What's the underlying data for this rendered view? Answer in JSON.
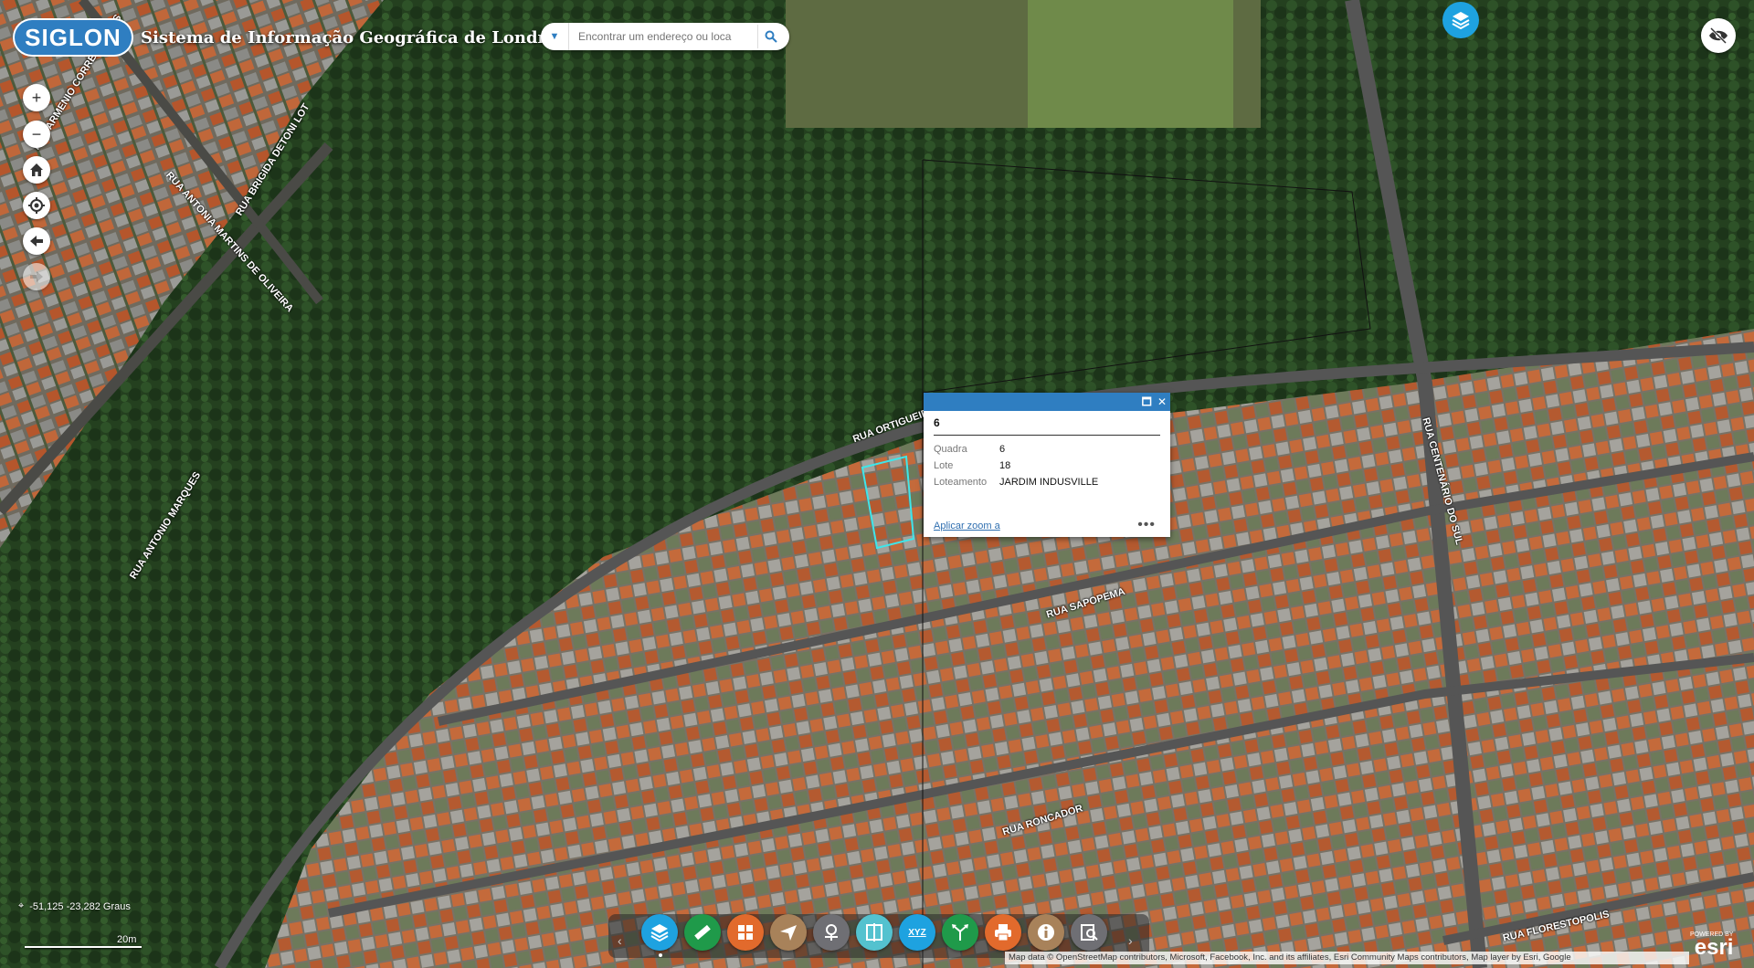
{
  "header": {
    "logo_text": "SIGLON",
    "title": "Sistema de Informação Geográfica de Londrina"
  },
  "search": {
    "placeholder": "Encontrar um endereço ou loca"
  },
  "nav": {
    "zoom_in": "+",
    "zoom_out": "−"
  },
  "streets": [
    {
      "label": "RUA ARMENIO CORREIA LENOS"
    },
    {
      "label": "RUA BRIGIDA DETONI LOT"
    },
    {
      "label": "RUA ANTONIA MARTINS DE OLIVEIRA"
    },
    {
      "label": "RUA ANTONIO MARQUES"
    },
    {
      "label": "RUA ORTIGUEIRA"
    },
    {
      "label": "RUA SAPOPEMA"
    },
    {
      "label": "RUA CENTENÁRIO DO SUL"
    },
    {
      "label": "RUA RONCADOR"
    },
    {
      "label": "RUA FLORESTOPOLIS"
    }
  ],
  "popup": {
    "title": "6",
    "fields": [
      {
        "key": "Quadra",
        "value": "6"
      },
      {
        "key": "Lote",
        "value": "18"
      },
      {
        "key": "Loteamento",
        "value": "JARDIM INDUSVILLE"
      }
    ],
    "zoom_link": "Aplicar zoom a",
    "more": "•••"
  },
  "coords": {
    "text": "-51,125 -23,282 Graus"
  },
  "scale": {
    "label": "20m"
  },
  "toolbar": {
    "tools": [
      {
        "name": "layers-tool",
        "color": "#1ea2e0"
      },
      {
        "name": "measure-tool",
        "color": "#1f9a4a"
      },
      {
        "name": "basemap-gallery-tool",
        "color": "#e26a2c"
      },
      {
        "name": "filter-tool",
        "color": "#a8825a"
      },
      {
        "name": "locate-tool",
        "color": "#6f6f74"
      },
      {
        "name": "swipe-tool",
        "color": "#54c2cf"
      },
      {
        "name": "xyz-coordinates-tool",
        "color": "#1ea2e0"
      },
      {
        "name": "directions-tool",
        "color": "#1f9a4a"
      },
      {
        "name": "print-tool",
        "color": "#e26a2c"
      },
      {
        "name": "about-tool",
        "color": "#a8825a"
      },
      {
        "name": "query-tool",
        "color": "#6f6f74"
      }
    ],
    "xyz_label": "XYZ",
    "prev": "‹",
    "next": "›"
  },
  "attribution": "Map data © OpenStreetMap contributors, Microsoft, Facebook, Inc. and its affiliates, Esri Community Maps contributors, Map layer by Esri, Google",
  "esri": {
    "powered": "POWERED BY",
    "name": "esri"
  }
}
